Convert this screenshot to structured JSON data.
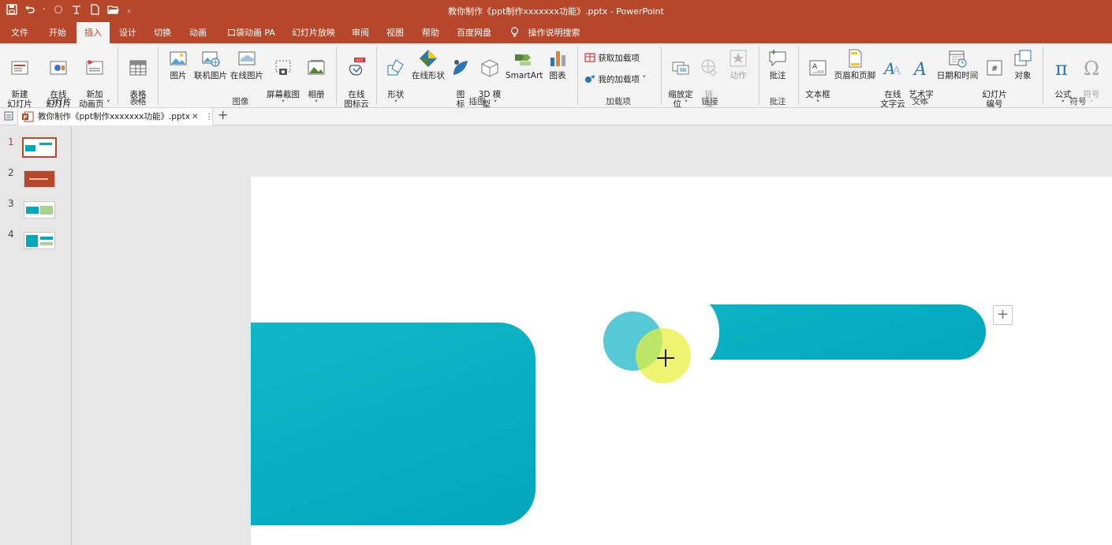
{
  "window": {
    "title": "教你制作《ppt制作xxxxxxx功能》.pptx  -  PowerPoint",
    "qat": [
      "save-icon",
      "undo-icon",
      "dropdown-icon",
      "redo-icon",
      "repeat-icon",
      "new-icon",
      "open-icon",
      "customize-icon"
    ]
  },
  "tabs": [
    {
      "label": "文件"
    },
    {
      "label": "开始"
    },
    {
      "label": "插入",
      "active": true
    },
    {
      "label": "设计"
    },
    {
      "label": "切换"
    },
    {
      "label": "动画"
    },
    {
      "label": "口袋动画 PA"
    },
    {
      "label": "幻灯片放映"
    },
    {
      "label": "审阅"
    },
    {
      "label": "视图"
    },
    {
      "label": "帮助"
    },
    {
      "label": "百度网盘"
    },
    {
      "label": "操作说明搜索"
    }
  ],
  "ribbon": {
    "buttons": {
      "new_slide": "新建\n幻灯片 ˅",
      "online_slide": "在线\n幻灯片 ˅",
      "new_anim_page": "新加\n动画页 ˅",
      "table": "表格\n˅",
      "picture": "图片",
      "online_picture": "联机图片",
      "online_pic2": "在线图片",
      "screenshot": "屏幕截图\n˅",
      "album": "相册\n˅",
      "online_iconcloud": "在线\n图标云",
      "shapes": "形状\n˅",
      "online_shapes": "在线形状",
      "icons": "图\n标",
      "model3d": "3D 模\n型 ˅",
      "smartart": "SmartArt",
      "chart": "图表",
      "get_addins": "获取加载项",
      "my_addins": "我的加载项  ˅",
      "zoom": "缩放定\n位 ˅",
      "link": "链\n接",
      "action": "动作",
      "comment": "批注",
      "textbox": "文本框\n˅",
      "header_footer": "页眉和页脚",
      "online_wordcloud": "在线\n文字云",
      "wordart": "艺术字\n˅",
      "datetime": "日期和时间",
      "slide_number": "幻灯片\n编号",
      "object": "对象",
      "equation": "公式\n˅",
      "symbol": "符号\n˅"
    },
    "groups": {
      "slides": "幻灯片",
      "tables": "表格",
      "images": "图像",
      "illustrations": "插图",
      "addins": "加载项",
      "links": "链接",
      "comments": "批注",
      "text": "文本",
      "symbols": "符号"
    }
  },
  "doc_tab": {
    "label": "教你制作《ppt制作xxxxxxx功能》.pptx",
    "close": "✕",
    "more": "⋮",
    "add": "+"
  },
  "thumbnails": [
    {
      "num": "1",
      "selected": true
    },
    {
      "num": "2",
      "selected": false
    },
    {
      "num": "3",
      "selected": false
    },
    {
      "num": "4",
      "selected": false
    }
  ],
  "slide": {
    "colors": {
      "teal": "#00a8bd",
      "light_teal": "#56c9d6",
      "highlight": "#e8f03c",
      "accent": "#b7472a"
    },
    "layout_options_icon": "+"
  }
}
